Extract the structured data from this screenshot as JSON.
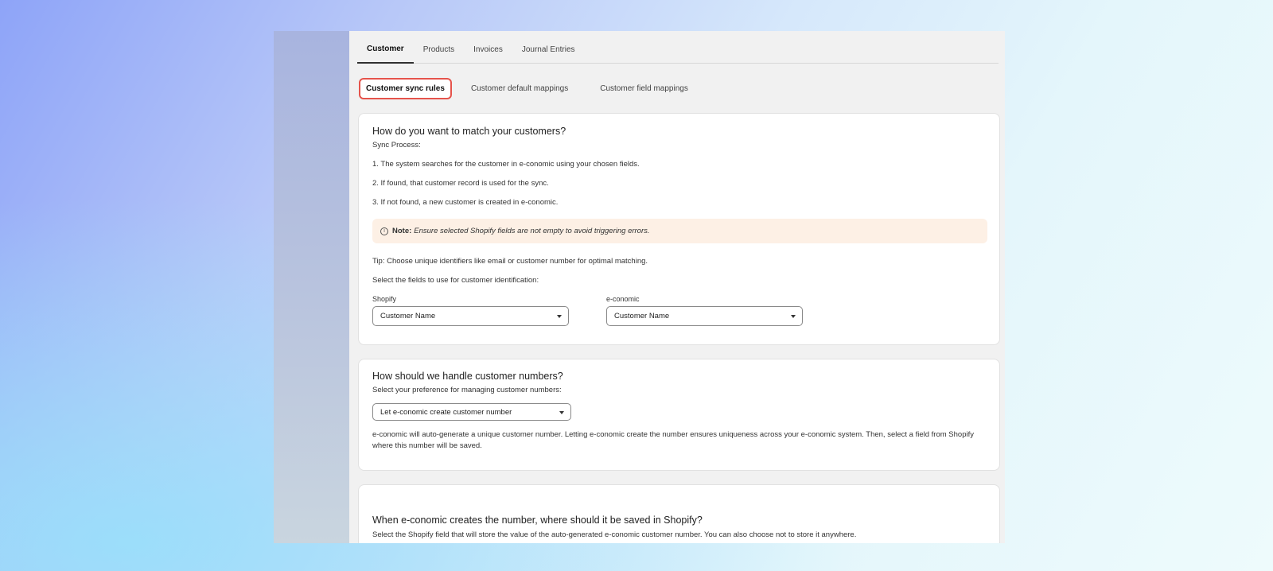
{
  "tabs": [
    "Customer",
    "Products",
    "Invoices",
    "Journal Entries"
  ],
  "subtabs": [
    "Customer sync rules",
    "Customer default mappings",
    "Customer field mappings"
  ],
  "match_card": {
    "title": "How do you want to match your customers?",
    "sync_process_label": "Sync Process:",
    "steps": [
      "1. The system searches for the customer in e-conomic using your chosen fields.",
      "2. If found, that customer record is used for the sync.",
      "3. If not found, a new customer is created in e-conomic."
    ],
    "note_icon": "i",
    "note_label": "Note:",
    "note_text": "Ensure selected Shopify fields are not empty to avoid triggering errors.",
    "tip": "Tip: Choose unique identifiers like email or customer number for optimal matching.",
    "select_fields_text": "Select the fields to use for customer identification:",
    "shopify_label": "Shopify",
    "shopify_value": "Customer Name",
    "economic_label": "e-conomic",
    "economic_value": "Customer Name"
  },
  "numbers_card": {
    "title": "How should we handle customer numbers?",
    "subtitle": "Select your preference for managing customer numbers:",
    "select_value": "Let e-conomic create customer number",
    "description_line1": "e-conomic will auto-generate a unique customer number. Letting e-conomic create the number ensures uniqueness across your e-conomic system. Then, select a field from Shopify",
    "description_line2": "where this number will be saved."
  },
  "save_card": {
    "title": "When e-conomic creates the number, where should it be saved in Shopify?",
    "subtitle": "Select the Shopify field that will store the value of the auto-generated e-conomic customer number. You can also choose not to store it anywhere."
  }
}
